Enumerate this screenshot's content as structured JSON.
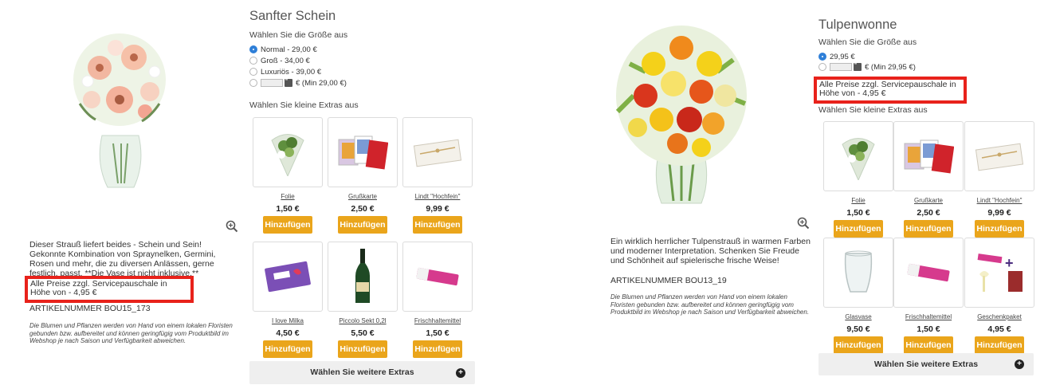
{
  "left": {
    "title": "Sanfter Schein",
    "size_label": "Wählen Sie die Größe aus",
    "sizes": [
      {
        "label": "Normal - 29,00 €",
        "selected": true
      },
      {
        "label": "Groß - 34,00 €",
        "selected": false
      },
      {
        "label": "Luxuriös - 39,00 €",
        "selected": false
      }
    ],
    "custom_size_label": "€ (Min 29,00 €)",
    "extras_label": "Wählen Sie kleine Extras aus",
    "extras": [
      {
        "name": "Folie",
        "price": "1,50 €",
        "button": "Hinzufügen",
        "icon": "foil-bouquet"
      },
      {
        "name": "Grußkarte",
        "price": "2,50 €",
        "button": "Hinzufügen",
        "icon": "greeting-cards"
      },
      {
        "name": "Lindt \"Hochfein\"",
        "price": "9,99 €",
        "button": "Hinzufügen",
        "icon": "chocolate-box"
      },
      {
        "name": "I love Milka",
        "price": "4,50 €",
        "button": "Hinzufügen",
        "icon": "milka-box"
      },
      {
        "name": "Piccolo Sekt 0,2l",
        "price": "5,50 €",
        "button": "Hinzufügen",
        "icon": "sparkling-wine-bottle"
      },
      {
        "name": "Frischhaltemittel",
        "price": "1,50 €",
        "button": "Hinzufügen",
        "icon": "flower-food-sachet"
      }
    ],
    "more_extras": "Wählen Sie weitere Extras",
    "description": "Dieser Strauß liefert beides - Schein und Sein! Gekonnte Kombination von Spraynelken, Germini, Rosen und mehr, die zu diversen Anlässen, gerne festlich, passt. **Die Vase ist nicht inklusive.**",
    "notice": "Alle Preise zzgl. Servicepauschale in Höhe von - 4,95 €",
    "article_number": "ARTIKELNUMMER BOU15_173",
    "disclaimer": "Die Blumen und Pflanzen werden von Hand von einem lokalen Floristen gebunden bzw. aufbereitet und können geringfügig vom Produktbild im Webshop je nach Saison und Verfügbarkeit abweichen."
  },
  "right": {
    "title": "Tulpenwonne",
    "size_label": "Wählen Sie die Größe aus",
    "sizes": [
      {
        "label": "29,95 €",
        "selected": true
      }
    ],
    "custom_size_label": "€ (Min 29,95 €)",
    "notice": "Alle Preise zzgl. Servicepauschale in Höhe von - 4,95 €",
    "extras_label": "Wählen Sie kleine Extras aus",
    "extras": [
      {
        "name": "Folie",
        "price": "1,50 €",
        "button": "Hinzufügen",
        "icon": "foil-bouquet"
      },
      {
        "name": "Grußkarte",
        "price": "2,50 €",
        "button": "Hinzufügen",
        "icon": "greeting-cards"
      },
      {
        "name": "Lindt \"Hochfein\"",
        "price": "9,99 €",
        "button": "Hinzufügen",
        "icon": "chocolate-box"
      },
      {
        "name": "Glasvase",
        "price": "9,50 €",
        "button": "Hinzufügen",
        "icon": "glass-vase"
      },
      {
        "name": "Frischhaltemittel",
        "price": "1,50 €",
        "button": "Hinzufügen",
        "icon": "flower-food-sachet"
      },
      {
        "name": "Geschenkpaket",
        "price": "4,95 €",
        "button": "Hinzufügen",
        "icon": "gift-package"
      }
    ],
    "more_extras": "Wählen Sie weitere Extras",
    "description": "Ein wirklich herrlicher Tulpenstrauß in warmen Farben und moderner Interpretation. Schenken Sie Freude und Schönheit auf spielerische frische Weise!",
    "article_number": "ARTIKELNUMMER BOU13_19",
    "disclaimer": "Die Blumen und Pflanzen werden von Hand von einem lokalen Floristen gebunden bzw. aufbereitet und können geringfügig vom Produktbild im Webshop je nach Saison und Verfügbarkeit abweichen."
  },
  "colors": {
    "accent_button": "#eaa51b",
    "highlight_border": "#e8221b",
    "radio_selected": "#2f7fd8"
  }
}
